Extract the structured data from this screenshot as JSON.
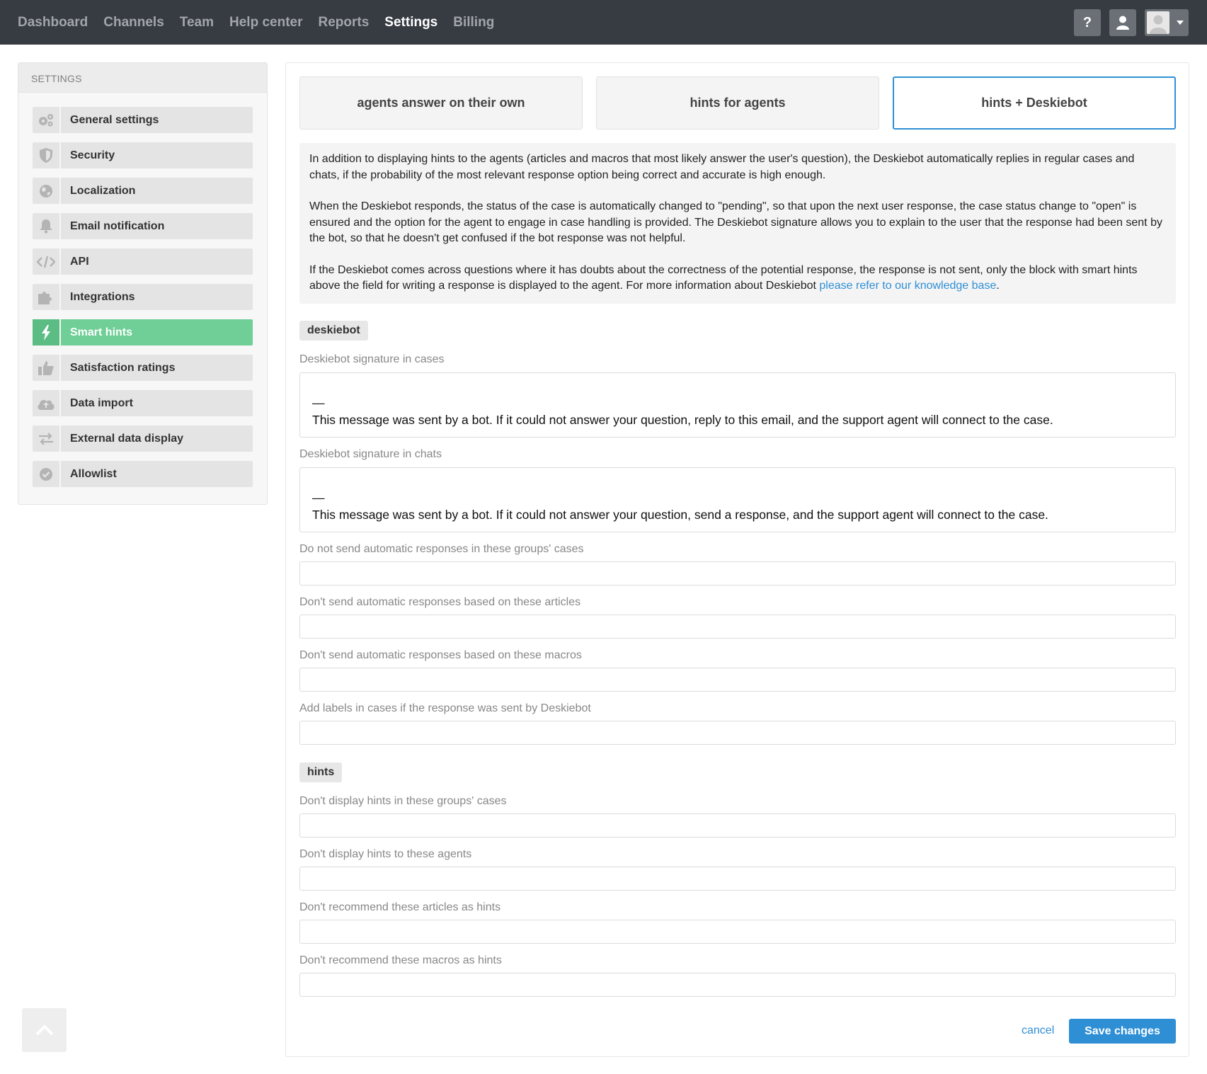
{
  "nav": {
    "items": [
      "Dashboard",
      "Channels",
      "Team",
      "Help center",
      "Reports",
      "Settings",
      "Billing"
    ],
    "active": "Settings",
    "help_label": "?"
  },
  "sidebar": {
    "title": "SETTINGS",
    "items": [
      {
        "label": "General settings",
        "icon": "gears-icon"
      },
      {
        "label": "Security",
        "icon": "shield-icon"
      },
      {
        "label": "Localization",
        "icon": "globe-icon"
      },
      {
        "label": "Email notification",
        "icon": "bell-icon"
      },
      {
        "label": "API",
        "icon": "code-icon"
      },
      {
        "label": "Integrations",
        "icon": "puzzle-icon"
      },
      {
        "label": "Smart hints",
        "icon": "lightning-icon",
        "active": true
      },
      {
        "label": "Satisfaction ratings",
        "icon": "thumbs-up-icon"
      },
      {
        "label": "Data import",
        "icon": "cloud-upload-icon"
      },
      {
        "label": "External data display",
        "icon": "arrows-exchange-icon"
      },
      {
        "label": "Allowlist",
        "icon": "check-badge-icon"
      }
    ]
  },
  "modes": {
    "tabs": [
      "agents answer on their own",
      "hints for agents",
      "hints + Deskiebot"
    ],
    "active": "hints + Deskiebot"
  },
  "description": {
    "p1": "In addition to displaying hints to the agents (articles and macros that most likely answer the user's question), the Deskiebot automatically replies in regular cases and chats, if the probability of the most relevant response option being correct and accurate is high enough.",
    "p2": "When the Deskiebot responds, the status of the case is automatically changed to \"pending\", so that upon the next user response, the case status change to \"open\" is ensured and the option for the agent to engage in case handling is provided. The Deskiebot signature allows you to explain to the user that the response had been sent by the bot, so that he doesn't get confused if the bot response was not helpful.",
    "p3_text": "If the Deskiebot comes across questions where it has doubts about the correctness of the potential response, the response is not sent, only the block with smart hints above the field for writing a response is displayed to the agent. For more information about Deskiebot ",
    "p3_link": "please refer to our knowledge base",
    "p3_end": "."
  },
  "deskiebot_section": {
    "tag": "deskiebot",
    "sig_cases_label": "Deskiebot signature in cases",
    "sig_cases_dash": "—",
    "sig_cases_text": "This message was sent by a bot. If it could not answer your question, reply to this email, and the support agent will connect to the case.",
    "sig_chats_label": "Deskiebot signature in chats",
    "sig_chats_dash": "—",
    "sig_chats_text": "This message was sent by a bot. If it could not answer your question, send a response, and the support agent will connect to the case.",
    "no_groups_label": "Do not send automatic responses in these groups' cases",
    "no_articles_label": "Don't send automatic responses based on these articles",
    "no_macros_label": "Don't send automatic responses based on these macros",
    "labels_label": "Add labels in cases if the response was sent by Deskiebot"
  },
  "hints_section": {
    "tag": "hints",
    "no_groups_label": "Don't display hints in these groups' cases",
    "no_agents_label": "Don't display hints to these agents",
    "no_articles_label": "Don't recommend these articles as hints",
    "no_macros_label": "Don't recommend these macros as hints"
  },
  "actions": {
    "cancel": "cancel",
    "save": "Save changes"
  },
  "colors": {
    "topbar": "#373c43",
    "accent": "#2f8fd5",
    "active_green": "#6fcf97"
  }
}
